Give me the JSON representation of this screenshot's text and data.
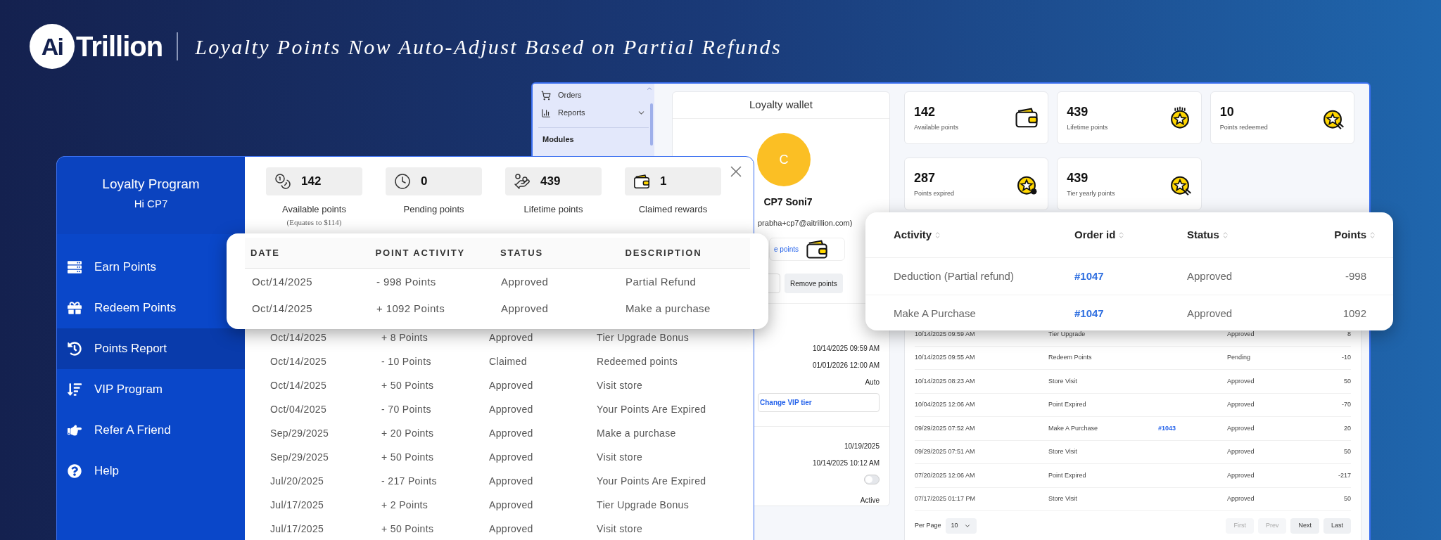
{
  "brand": {
    "logo_mark": "Ai",
    "logo_text": "Trillion",
    "tagline": "Loyalty Points Now Auto-Adjust Based on Partial Refunds"
  },
  "admin": {
    "sidebar": {
      "items": [
        {
          "label": "Orders",
          "kind": "link"
        },
        {
          "label": "Reports",
          "kind": "menu"
        }
      ],
      "section": "Modules"
    },
    "wallet": {
      "title": "Loyalty wallet",
      "avatar_initial": "C",
      "name": "CP7 Soni7",
      "email": "prabha+cp7@aitrillion.com)",
      "link": "e points",
      "remove_button": "Remove points",
      "details": [
        "10/14/2025 09:59 AM",
        "01/01/2026 12:00 AM",
        "Auto"
      ],
      "tier_button": "Change VIP tier",
      "details_2": [
        "10/19/2025",
        "10/14/2025 10:12 AM"
      ],
      "toggle": {
        "on": false
      },
      "status": "Active"
    },
    "stats": [
      {
        "value": "142",
        "label": "Available points"
      },
      {
        "value": "439",
        "label": "Lifetime points"
      },
      {
        "value": "10",
        "label": "Points redeemed"
      },
      {
        "value": "287",
        "label": "Points expired"
      },
      {
        "value": "439",
        "label": "Tier yearly points"
      }
    ],
    "table": {
      "rows": [
        {
          "date": "10/14/2025 09:59 AM",
          "activity": "Tier Upgrade",
          "status": "Approved",
          "points": "8"
        },
        {
          "date": "10/14/2025 09:55 AM",
          "activity": "Redeem Points",
          "status": "Pending",
          "points": "-10"
        },
        {
          "date": "10/14/2025 08:23 AM",
          "activity": "Store Visit",
          "status": "Approved",
          "points": "50"
        },
        {
          "date": "10/04/2025 12:06 AM",
          "activity": "Point Expired",
          "status": "Approved",
          "points": "-70"
        },
        {
          "date": "09/29/2025 07:52 AM",
          "activity": "Make A Purchase",
          "order": "#1043",
          "status": "Approved",
          "points": "20"
        },
        {
          "date": "09/29/2025 07:51 AM",
          "activity": "Store Visit",
          "status": "Approved",
          "points": "50"
        },
        {
          "date": "07/20/2025 12:06 AM",
          "activity": "Point Expired",
          "status": "Approved",
          "points": "-217"
        },
        {
          "date": "07/17/2025 01:17 PM",
          "activity": "Store Visit",
          "status": "Approved",
          "points": "50"
        }
      ],
      "per_page_label": "Per Page",
      "per_page": "10",
      "pages": [
        {
          "label": "First",
          "disabled": true
        },
        {
          "label": "Prev",
          "disabled": true
        },
        {
          "label": "Next",
          "disabled": false
        },
        {
          "label": "Last",
          "disabled": false
        }
      ]
    }
  },
  "widget": {
    "title": "Loyalty Program",
    "greeting": "Hi CP7",
    "menu": [
      {
        "label": "Earn Points",
        "selected": false
      },
      {
        "label": "Redeem Points",
        "selected": false
      },
      {
        "label": "Points Report",
        "selected": true
      },
      {
        "label": "VIP Program",
        "selected": false
      },
      {
        "label": "Refer A Friend",
        "selected": false
      },
      {
        "label": "Help",
        "selected": false
      }
    ],
    "stats": [
      {
        "value": "142",
        "label": "Available points",
        "note": "(Equates to $114)"
      },
      {
        "value": "0",
        "label": "Pending points"
      },
      {
        "value": "439",
        "label": "Lifetime points"
      },
      {
        "value": "1",
        "label": "Claimed rewards"
      }
    ],
    "rows": [
      [
        "Oct/14/2025",
        "+ 8 Points",
        "Approved",
        "Tier Upgrade Bonus"
      ],
      [
        "Oct/14/2025",
        "- 10 Points",
        "Claimed",
        "Redeemed points"
      ],
      [
        "Oct/14/2025",
        "+ 50 Points",
        "Approved",
        "Visit store"
      ],
      [
        "Oct/04/2025",
        "- 70 Points",
        "Approved",
        "Your Points Are Expired"
      ],
      [
        "Sep/29/2025",
        "+ 20 Points",
        "Approved",
        "Make a purchase"
      ],
      [
        "Sep/29/2025",
        "+ 50 Points",
        "Approved",
        "Visit store"
      ],
      [
        "Jul/20/2025",
        "- 217 Points",
        "Approved",
        "Your Points Are Expired"
      ],
      [
        "Jul/17/2025",
        "+ 2 Points",
        "Approved",
        "Tier Upgrade Bonus"
      ],
      [
        "Jul/17/2025",
        "+ 50 Points",
        "Approved",
        "Visit store"
      ]
    ]
  },
  "popup_report": {
    "columns": [
      "DATE",
      "POINT ACTIVITY",
      "STATUS",
      "DESCRIPTION"
    ],
    "rows": [
      [
        "Oct/14/2025",
        "- 998 Points",
        "Approved",
        "Partial Refund"
      ],
      [
        "Oct/14/2025",
        "+ 1092 Points",
        "Approved",
        "Make a purchase"
      ]
    ]
  },
  "popup_activity": {
    "columns": [
      "Activity",
      "Order id",
      "Status",
      "Points"
    ],
    "rows": [
      {
        "activity": "Deduction (Partial refund)",
        "order": "#1047",
        "status": "Approved",
        "points": "-998"
      },
      {
        "activity": "Make A Purchase",
        "order": "#1047",
        "status": "Approved",
        "points": "1092"
      }
    ]
  }
}
